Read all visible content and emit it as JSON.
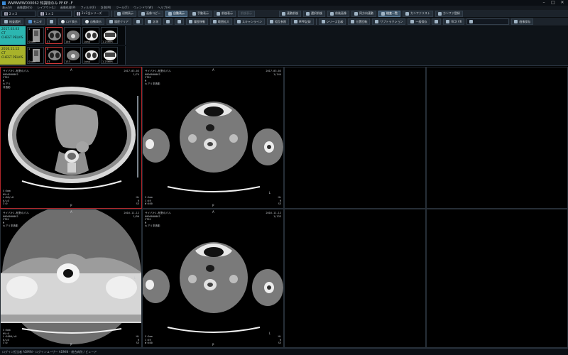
{
  "window": {
    "title": "WWWWW000062 知識物のみ PF.KF...F",
    "controls": [
      "–",
      "□",
      "✕"
    ]
  },
  "menu": [
    "表示(V)",
    "画像選択(S)",
    "レイアウト(L)",
    "画像処理(P)",
    "フィルタ(F)",
    "計測(M)",
    "ツール(T)",
    "ウィンドウ(W)",
    "ヘルプ(H)"
  ],
  "toolbar1": {
    "layout_select": "2 × 2",
    "series_select": "1 × 2",
    "series_mode": "2×2全シリーズ",
    "buttons": [
      "初期表示",
      "画像コピー",
      "自動表示",
      "手動表示",
      "前後表示",
      "前後表示",
      "連動前後",
      "選択前後",
      "前後画像",
      "同方向連動",
      "検査一覧",
      "カンファリスト",
      "カンファ登録"
    ]
  },
  "toolbar2": {
    "buttons": [
      "検査選択",
      "モニタ",
      "",
      "ロケ表示",
      "自動表示",
      "履歴クリア",
      "",
      "計測",
      "",
      "",
      "履歴移動",
      "範囲拡大",
      "スキャンライン",
      "相互参照",
      "MPR記録",
      "",
      "シリーズ比較",
      "位置回転",
      "サブトラクション",
      "一般保存",
      "",
      "RCX VR",
      "",
      "画像保存"
    ]
  },
  "studies": [
    {
      "date": "2017.03.03",
      "type": "CT",
      "desc": "CHEST PELVIS",
      "thumbs": [
        {
          "count": "1",
          "label": "Scout"
        },
        {
          "count": "4",
          "label": "CT"
        },
        {
          "count": "",
          "label": "146"
        },
        {
          "count": "",
          "label": "Lung"
        },
        {
          "count": "",
          "label": "1.25mm"
        }
      ]
    },
    {
      "date": "2016.11.12",
      "type": "CT",
      "desc": "CHEST PELVIS",
      "thumbs": [
        {
          "count": "1",
          "label": "Scout"
        },
        {
          "count": "4",
          "label": "CT"
        },
        {
          "count": "",
          "label": "133"
        },
        {
          "count": "",
          "label": "Lung"
        },
        {
          "count": "",
          "label": "1.25mm"
        }
      ]
    }
  ],
  "panes": [
    {
      "top_left": "サイバナ1-松野のパル\n0000000062\nCT01\nM\nキアリ\n非造影",
      "top_right": "2017-03-03\n1/74",
      "bottom_left": "S:5mm\nHV:0\nL:60/+0\n0/+0\n3:0",
      "bottom_right": "HL\nR\nSE",
      "marker_top": "A",
      "marker_bottom": "P",
      "marker_right": "L"
    },
    {
      "top_left": "サイバナ1-松野のパル\n0000000062\nCT01\nM\nキアリ非造影",
      "top_right": "2017-03-03\n1/144",
      "bottom_left": "S:1mm\nC:49\nW:400",
      "bottom_right": "HL\nR\nSE",
      "marker_top": "A",
      "marker_bottom": "P",
      "marker_right": "L"
    },
    {
      "top_left": "サイバナ1-松野のパル\n0000000062\nCT01\nM\nキアリ非造影",
      "top_right": "2016-11-12\n1/90",
      "bottom_left": "S:5mm\nHV:0\nL:1000/+0\n0/+0\n3:0",
      "bottom_right": "HL\nR\nSE",
      "marker_top": "A",
      "marker_bottom": "P",
      "marker_right": "L"
    },
    {
      "top_left": "サイバナ1-松野のパル\n0000000062\nCT01\nM\nキアリ非造影",
      "top_right": "2016-11-12\n1/133",
      "bottom_left": "S:1mm\nC:49\nW:400",
      "bottom_right": "HL\nR\nSE",
      "marker_top": "A",
      "marker_bottom": "P",
      "marker_right": "L"
    }
  ],
  "status": "ログイン担当者 ADMIN・ログインユーザー ADMIN・総合病院 / ビューア"
}
